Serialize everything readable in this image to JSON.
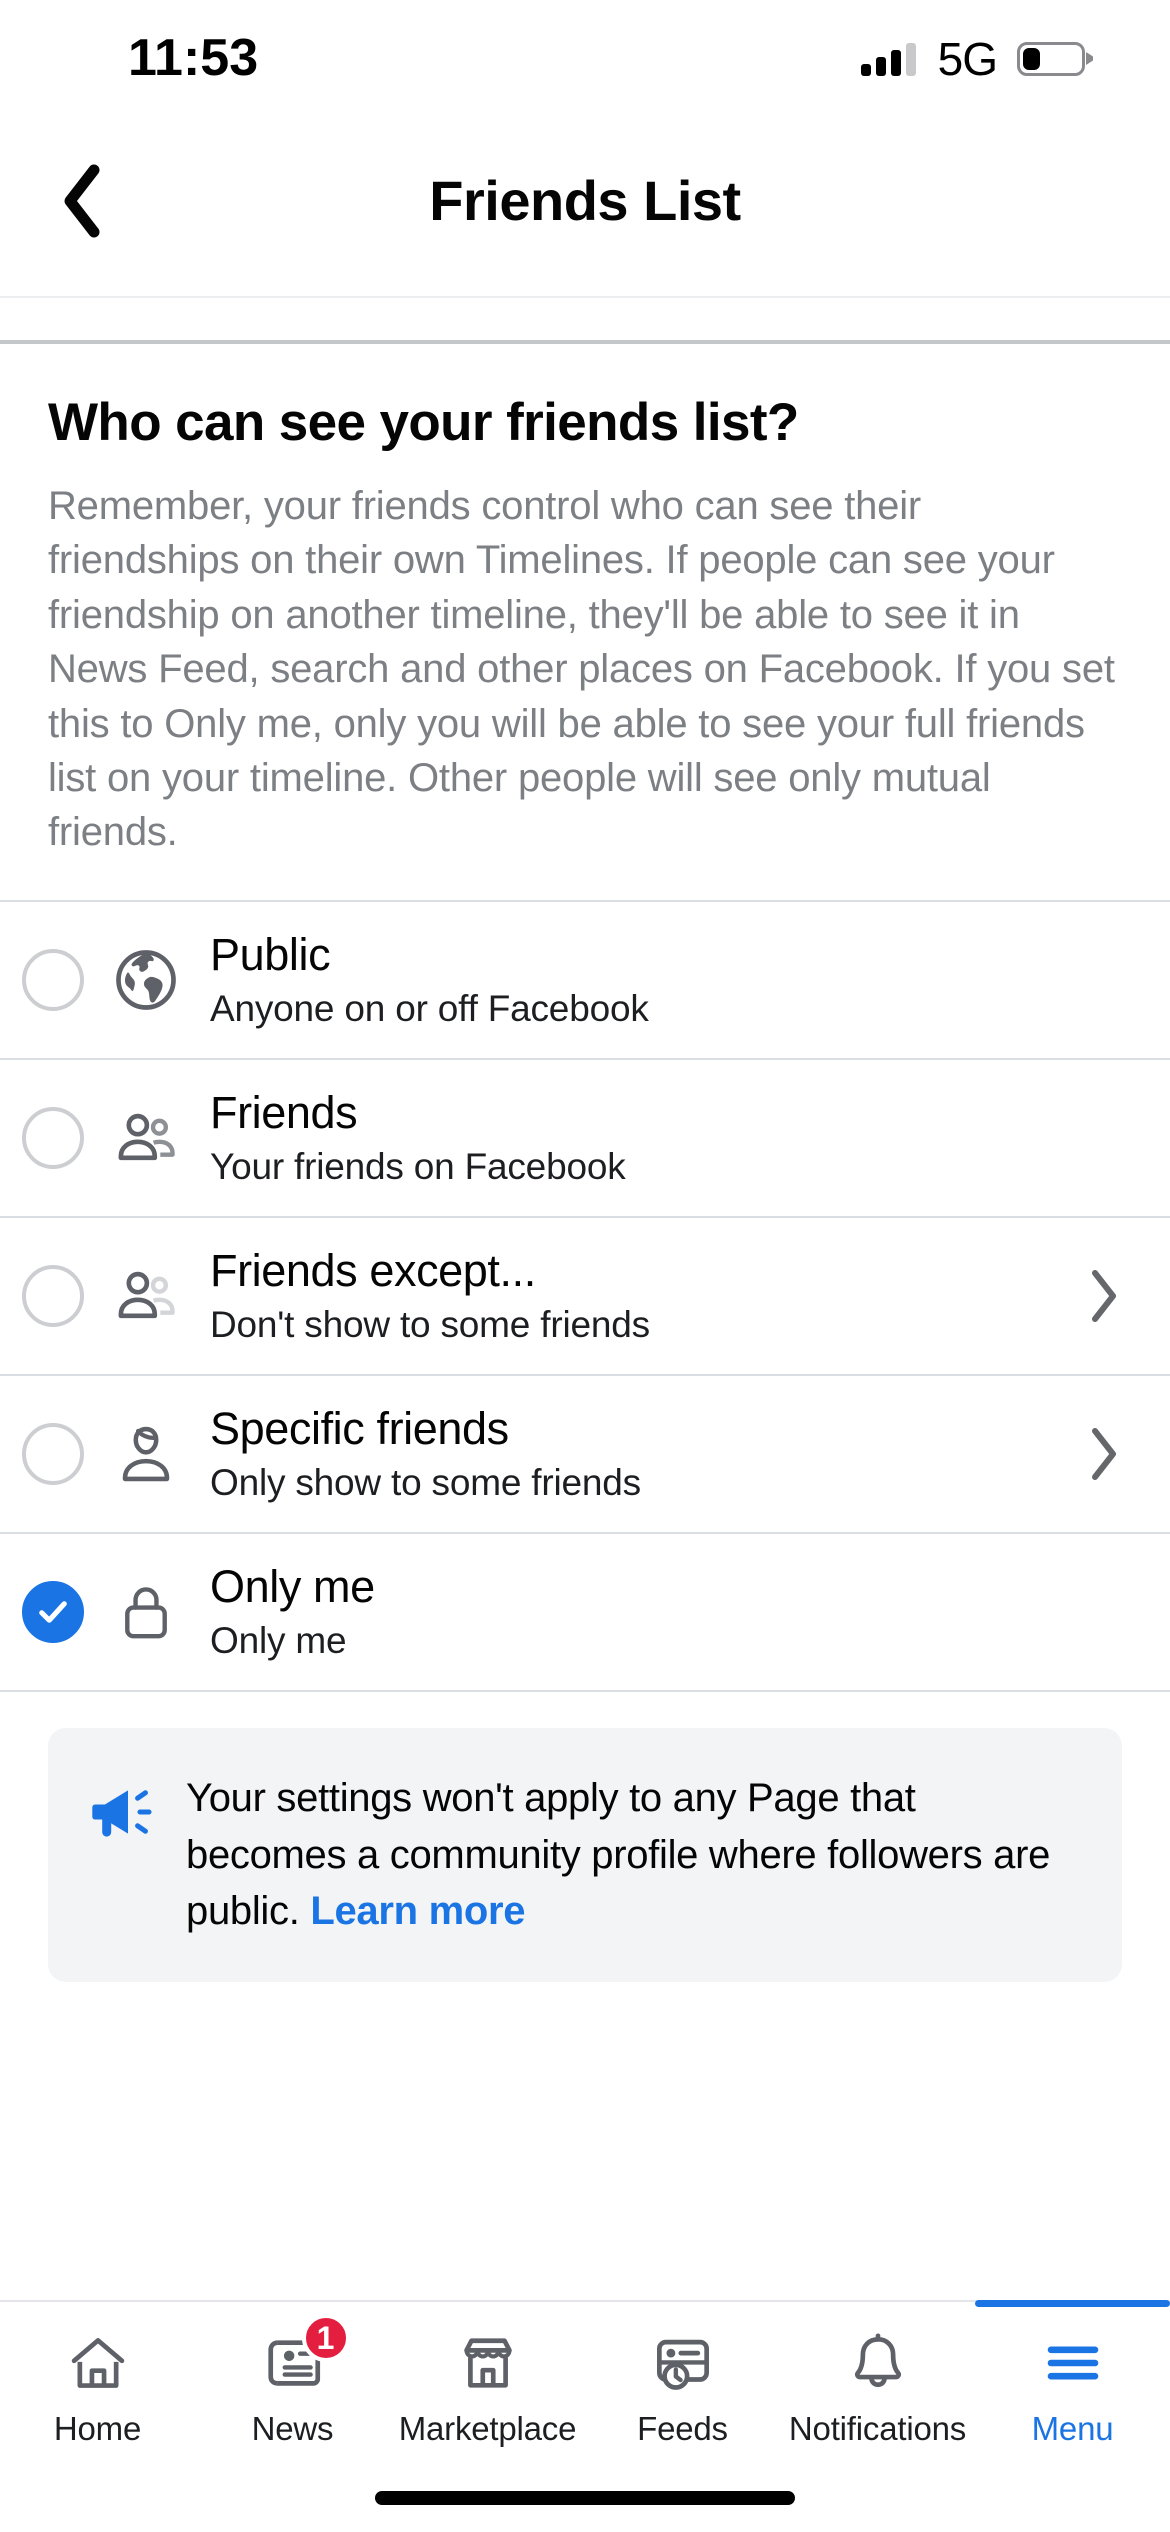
{
  "status_bar": {
    "time": "11:53",
    "network": "5G",
    "signal_bars_total": 4,
    "signal_bars_active": 3,
    "battery_percent": 30
  },
  "header": {
    "back_icon": "chevron-left-icon",
    "title": "Friends List"
  },
  "description": {
    "title": "Who can see your friends list?",
    "body": "Remember, your friends control who can see their friendships on their own Timelines. If people can see your friendship on another timeline, they'll be able to see it in News Feed, search and other places on Facebook. If you set this to Only me, only you will be able to see your full friends list on your timeline. Other people will see only mutual friends."
  },
  "options": [
    {
      "label": "Public",
      "sublabel": "Anyone on or off Facebook",
      "icon": "globe-icon",
      "selected": false,
      "has_chevron": false
    },
    {
      "label": "Friends",
      "sublabel": "Your friends on Facebook",
      "icon": "friends-icon",
      "selected": false,
      "has_chevron": false
    },
    {
      "label": "Friends except...",
      "sublabel": "Don't show to some friends",
      "icon": "friends-except-icon",
      "selected": false,
      "has_chevron": true
    },
    {
      "label": "Specific friends",
      "sublabel": "Only show to some friends",
      "icon": "person-icon",
      "selected": false,
      "has_chevron": true
    },
    {
      "label": "Only me",
      "sublabel": "Only me",
      "icon": "lock-icon",
      "selected": true,
      "has_chevron": false
    }
  ],
  "banner": {
    "icon": "megaphone-icon",
    "text": "Your settings won't apply to any Page that becomes a community profile where followers are public. ",
    "link_label": "Learn more"
  },
  "tab_bar": {
    "tabs": [
      {
        "label": "Home",
        "icon": "home-icon",
        "active": false,
        "badge": ""
      },
      {
        "label": "News",
        "icon": "news-icon",
        "active": false,
        "badge": "1"
      },
      {
        "label": "Marketplace",
        "icon": "marketplace-icon",
        "active": false,
        "badge": ""
      },
      {
        "label": "Feeds",
        "icon": "feeds-icon",
        "active": false,
        "badge": ""
      },
      {
        "label": "Notifications",
        "icon": "bell-icon",
        "active": false,
        "badge": ""
      },
      {
        "label": "Menu",
        "icon": "hamburger-menu-icon",
        "active": true,
        "badge": ""
      }
    ]
  },
  "colors": {
    "accent_blue": "#1b74e4",
    "badge_red": "#e41e3f",
    "icon_gray": "#5e6167",
    "muted_text": "#7c7f83"
  }
}
